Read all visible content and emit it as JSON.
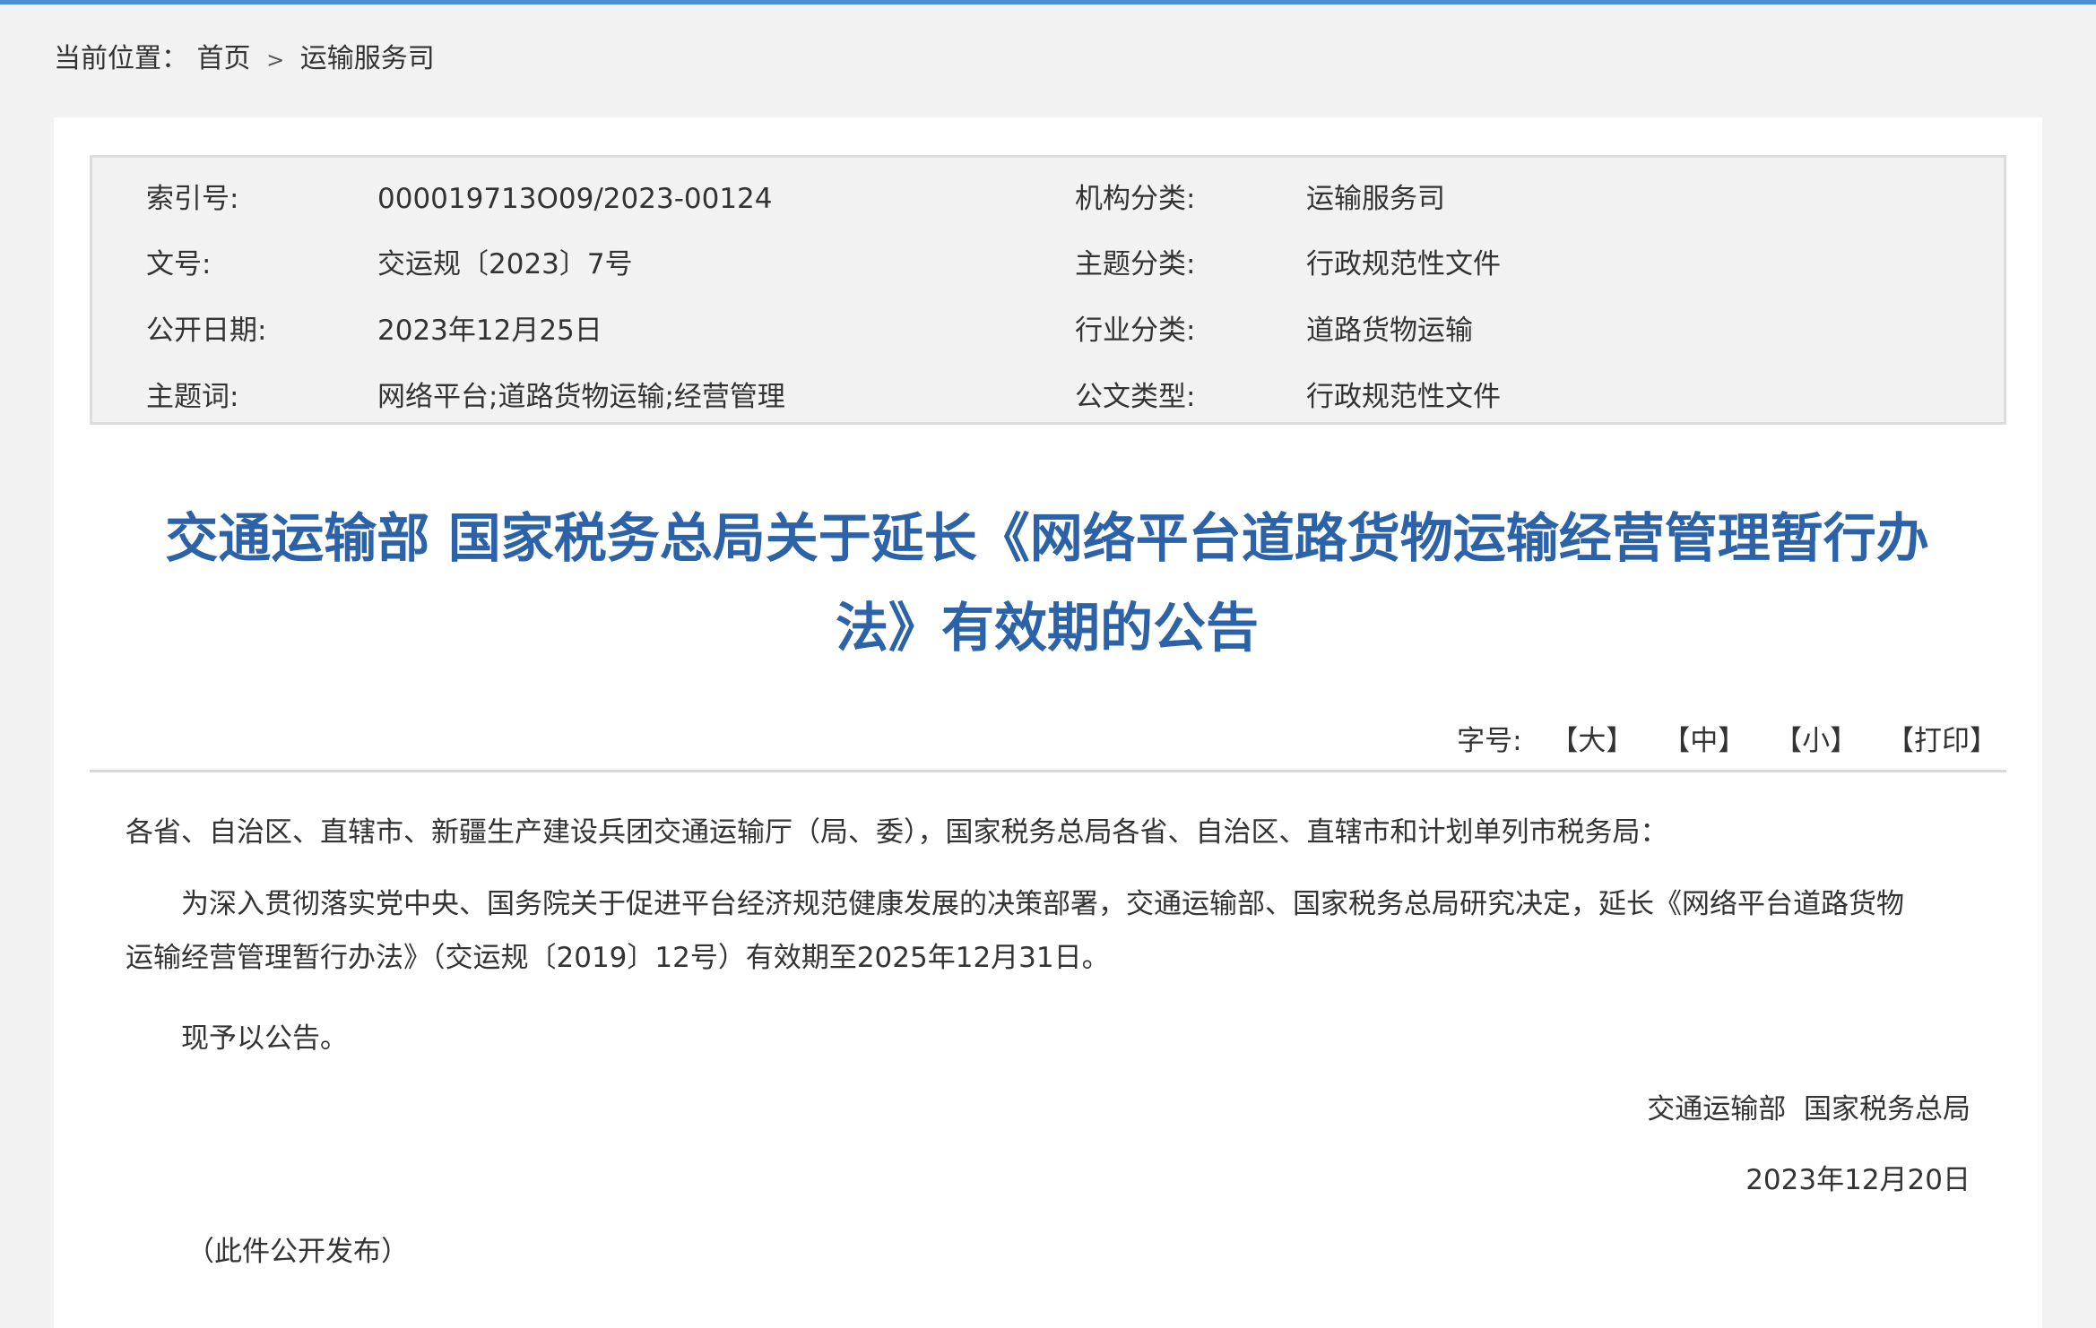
{
  "breadcrumb": {
    "label": "当前位置：",
    "home": "首页",
    "separator": ">",
    "current": "运输服务司"
  },
  "meta": {
    "rows": [
      {
        "k1": "索引号:",
        "v1": "000019713O09/2023-00124",
        "k2": "机构分类:",
        "v2": "运输服务司"
      },
      {
        "k1": "文号:",
        "v1": "交运规〔2023〕7号",
        "k2": "主题分类:",
        "v2": "行政规范性文件"
      },
      {
        "k1": "公开日期:",
        "v1": "2023年12月25日",
        "k2": "行业分类:",
        "v2": "道路货物运输"
      },
      {
        "k1": "主题词:",
        "v1": "网络平台;道路货物运输;经营管理",
        "k2": "公文类型:",
        "v2": "行政规范性文件"
      }
    ]
  },
  "article": {
    "title_line1": "交通运输部 国家税务总局关于延长《网络平台道路货物运输经营管理暂行办",
    "title_line2": "法》有效期的公告",
    "font_label": "字号:",
    "font_large": "【大】",
    "font_medium": "【中】",
    "font_small": "【小】",
    "print": "【打印】",
    "salutation": "各省、自治区、直辖市、新疆生产建设兵团交通运输厅（局、委），国家税务总局各省、自治区、直辖市和计划单列市税务局：",
    "para1_line1": "为深入贯彻落实党中央、国务院关于促进平台经济规范健康发展的决策部署，交通运输部、国家税务总局研究决定，延长《网络平台道路货物",
    "para1_line2": "运输经营管理暂行办法》（交运规〔2019〕12号）有效期至2025年12月31日。",
    "para2": "现予以公告。",
    "signature_org": "交通运输部  国家税务总局",
    "signature_date": "2023年12月20日",
    "public_note": "（此件公开发布）"
  },
  "colors": {
    "title": "#2c62a8",
    "top_bar": "#4a8fd6",
    "page_bg": "#f2f2f2",
    "panel_bg": "#ffffff"
  }
}
